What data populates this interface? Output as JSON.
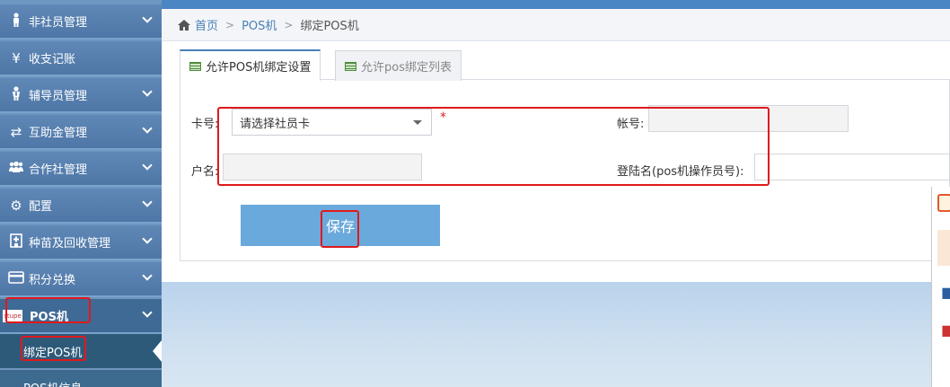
{
  "sidebar": {
    "items": [
      {
        "label": "非社员管理",
        "icon": "person-icon"
      },
      {
        "label": "收支记账",
        "icon": "yen-icon"
      },
      {
        "label": "辅导员管理",
        "icon": "person-tie-icon"
      },
      {
        "label": "互助金管理",
        "icon": "exchange-icon"
      },
      {
        "label": "合作社管理",
        "icon": "group-icon"
      },
      {
        "label": "配置",
        "icon": "gears-icon"
      },
      {
        "label": "种苗及回收管理",
        "icon": "hospital-icon"
      },
      {
        "label": "积分兑换",
        "icon": "credit-card-icon"
      },
      {
        "label": "POS机",
        "icon": "stupe-logo-icon"
      }
    ],
    "sub_items": [
      {
        "label": "绑定POS机"
      },
      {
        "label": "POS机信息"
      }
    ],
    "stupe_text": "stupe"
  },
  "breadcrumb": {
    "home": "首页",
    "level1": "POS机",
    "current": "绑定POS机"
  },
  "tabs": [
    {
      "label": "允许POS机绑定设置"
    },
    {
      "label": "允许pos绑定列表"
    }
  ],
  "form": {
    "card_label": "卡号:",
    "card_select_value": "请选择社员卡",
    "required_mark": "*",
    "account_label": "帐号:",
    "account_value": "",
    "name_label": "户名:",
    "name_value": "",
    "login_label": "登陆名(pos机操作员号):",
    "login_value": "",
    "save_label": "保存"
  },
  "colors": {
    "sidebar": "#4e76a6",
    "accent": "#4a7fb8",
    "save_button": "#6aa9dc",
    "annotation": "#e0191c"
  }
}
